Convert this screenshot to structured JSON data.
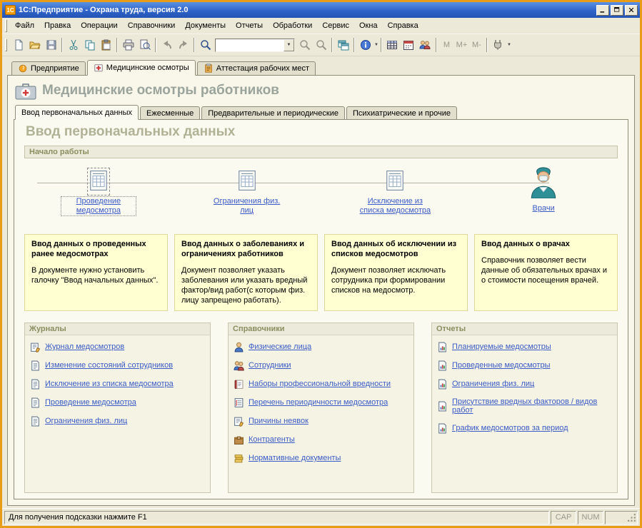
{
  "titlebar": {
    "title": "1С:Предприятие - Охрана труда, версия 2.0"
  },
  "menubar": {
    "items": [
      "Файл",
      "Правка",
      "Операции",
      "Справочники",
      "Документы",
      "Отчеты",
      "Обработки",
      "Сервис",
      "Окна",
      "Справка"
    ]
  },
  "toolbar": {
    "memory": [
      "M",
      "M+",
      "M-"
    ]
  },
  "tabs": {
    "main": [
      "Предприятие",
      "Медицинские осмотры",
      "Аттестация рабочих мест"
    ],
    "sub": [
      "Ввод первоначальных данных",
      "Ежесменные",
      "Предварительные и периодические",
      "Психиатрические и прочие"
    ]
  },
  "page": {
    "title": "Медицинские осмотры работников",
    "section_heading": "Ввод первоначальных данных"
  },
  "start": {
    "header": "Начало работы",
    "flow": [
      "Проведение медосмотра",
      "Ограничения физ. лиц",
      "Исключение из списка медосмотра",
      "Врачи"
    ],
    "cards": [
      {
        "title": "Ввод данных о проведенных ранее медосмотрах",
        "text": "В документе нужно установить галочку \"Ввод начальных данных\"."
      },
      {
        "title": "Ввод данных о заболеваниях и ограничениях работников",
        "text": "Документ позволяет указать заболевания или указать вредный фактор/вид работ(с которым физ. лицу запрещено работать)."
      },
      {
        "title": "Ввод данных об исключении из списков медосмотров",
        "text": "Документ позволяет исключать сотрудника при формировании списков на медосмотр."
      },
      {
        "title": "Ввод данных о врачах",
        "text": "Справочник позволяет вести данные об обязательных врачах и о стоимости посещения врачей."
      }
    ]
  },
  "columns": [
    {
      "header": "Журналы",
      "links": [
        "Журнал медосмотров",
        "Изменение состояний сотрудников",
        "Исключение из списка медосмотра",
        "Проведение медосмотра",
        "Ограничения физ. лиц"
      ]
    },
    {
      "header": "Справочники",
      "links": [
        "Физические лица",
        "Сотрудники",
        "Наборы профессиональной вредности",
        "Перечень периодичности медосмотра",
        "Причины неявок",
        "Контрагенты",
        "Нормативные документы"
      ]
    },
    {
      "header": "Отчеты",
      "links": [
        "Планируемые медосмотры",
        "Проведенные медосмотры",
        "Ограничения физ. лиц",
        "Присутствие вредных факторов / видов работ",
        "График медосмотров за период"
      ]
    }
  ],
  "statusbar": {
    "text": "Для получения подсказки нажмите F1",
    "cap": "CAP",
    "num": "NUM"
  }
}
